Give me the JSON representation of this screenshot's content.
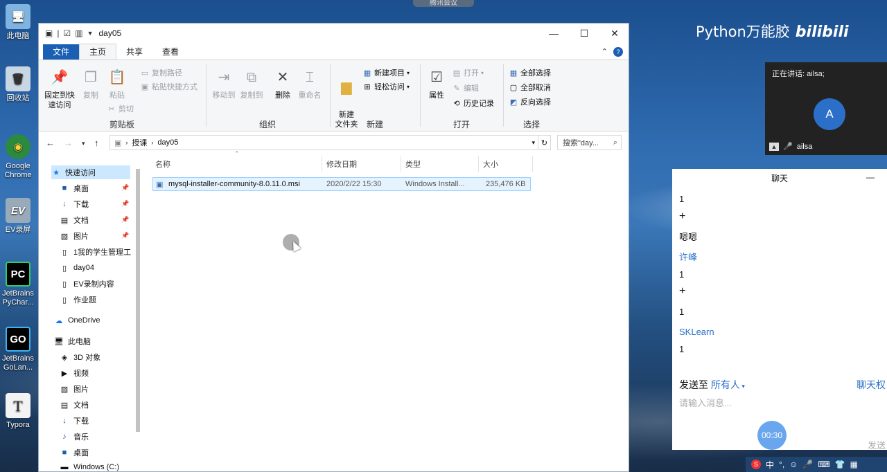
{
  "desktop": {
    "icons": [
      {
        "label": "此电脑",
        "glyph": "🖥"
      },
      {
        "label": "回收站",
        "glyph": "🗑"
      },
      {
        "label": "Google Chrome",
        "glyph": "◉"
      },
      {
        "label": "EV录屏",
        "glyph": "EV"
      },
      {
        "label": "JetBrains PyChar...",
        "glyph": "PC"
      },
      {
        "label": "JetBrains GoLan...",
        "glyph": "GO"
      },
      {
        "label": "Typora",
        "glyph": "T"
      }
    ],
    "meeting_tab": "腾讯会议",
    "brand_text": "Python万能胶",
    "brand_logo": "bilibili"
  },
  "explorer": {
    "title": "day05",
    "controls": {
      "minimize": "—",
      "maximize": "☐",
      "close": "✕"
    },
    "tabs": [
      "文件",
      "主页",
      "共享",
      "查看"
    ],
    "ribbon": {
      "clipboard": {
        "group": "剪贴板",
        "pin": "固定到快速访问",
        "copy": "复制",
        "paste": "粘贴",
        "copy_path": "复制路径",
        "paste_shortcut": "粘贴快捷方式",
        "cut": "剪切"
      },
      "organize": {
        "group": "组织",
        "move_to": "移动到",
        "copy_to": "复制到",
        "delete": "删除",
        "rename": "重命名"
      },
      "new": {
        "group": "新建",
        "new_folder": "新建\n文件夹",
        "new_item": "新建项目",
        "easy_access": "轻松访问"
      },
      "open": {
        "group": "打开",
        "properties": "属性",
        "open": "打开",
        "edit": "编辑",
        "history": "历史记录"
      },
      "select": {
        "group": "选择",
        "select_all": "全部选择",
        "select_none": "全部取消",
        "invert": "反向选择"
      }
    },
    "address": {
      "crumbs": [
        "授课",
        "day05"
      ],
      "search_placeholder": "搜索\"day..."
    },
    "nav": [
      {
        "label": "快速访问",
        "glyph": "★",
        "pinned": false
      },
      {
        "label": "桌面",
        "glyph": "■",
        "pinned": true
      },
      {
        "label": "下载",
        "glyph": "↓",
        "pinned": true
      },
      {
        "label": "文档",
        "glyph": "▤",
        "pinned": true
      },
      {
        "label": "图片",
        "glyph": "▧",
        "pinned": true
      },
      {
        "label": "1我的学生管理工",
        "glyph": "▯",
        "pinned": false
      },
      {
        "label": "day04",
        "glyph": "▯",
        "pinned": false
      },
      {
        "label": "EV录制内容",
        "glyph": "▯",
        "pinned": false
      },
      {
        "label": "作业题",
        "glyph": "▯",
        "pinned": false
      },
      {
        "label": "OneDrive",
        "glyph": "☁",
        "pinned": false
      },
      {
        "label": "此电脑",
        "glyph": "🖥",
        "pinned": false
      },
      {
        "label": "3D 对象",
        "glyph": "◈",
        "pinned": false
      },
      {
        "label": "视频",
        "glyph": "▶",
        "pinned": false
      },
      {
        "label": "图片",
        "glyph": "▧",
        "pinned": false
      },
      {
        "label": "文档",
        "glyph": "▤",
        "pinned": false
      },
      {
        "label": "下载",
        "glyph": "↓",
        "pinned": false
      },
      {
        "label": "音乐",
        "glyph": "♪",
        "pinned": false
      },
      {
        "label": "桌面",
        "glyph": "■",
        "pinned": false
      },
      {
        "label": "Windows (C:)",
        "glyph": "▬",
        "pinned": false
      }
    ],
    "columns": [
      "名称",
      "修改日期",
      "类型",
      "大小"
    ],
    "files": [
      {
        "name": "mysql-installer-community-8.0.11.0.msi",
        "modified": "2020/2/22 15:30",
        "type": "Windows Install...",
        "size": "235,476 KB"
      }
    ]
  },
  "meeting": {
    "speaking": "正在讲话: ailsa;",
    "avatar_letter": "A",
    "participant": "ailsa"
  },
  "chat": {
    "title": "聊天",
    "minimize": "—",
    "messages": [
      {
        "text": "1",
        "kind": "msg"
      },
      {
        "text": "+",
        "kind": "msg"
      },
      {
        "text": "嗯嗯",
        "kind": "msg"
      },
      {
        "text": "许峰",
        "kind": "name"
      },
      {
        "text": "1",
        "kind": "msg"
      },
      {
        "text": "+",
        "kind": "msg"
      },
      {
        "text": "1",
        "kind": "msg"
      },
      {
        "text": "SKLearn",
        "kind": "name"
      },
      {
        "text": "1",
        "kind": "msg"
      }
    ],
    "send_to_label": "发送至",
    "send_to_target": "所有人",
    "permission": "聊天权",
    "input_placeholder": "请输入消息...",
    "timer": "00:30",
    "send": "发送"
  },
  "tray": {
    "ime": "中",
    "items": [
      "S",
      "°,",
      "☺",
      "🎤",
      "⌨",
      "👕",
      "▦"
    ]
  }
}
